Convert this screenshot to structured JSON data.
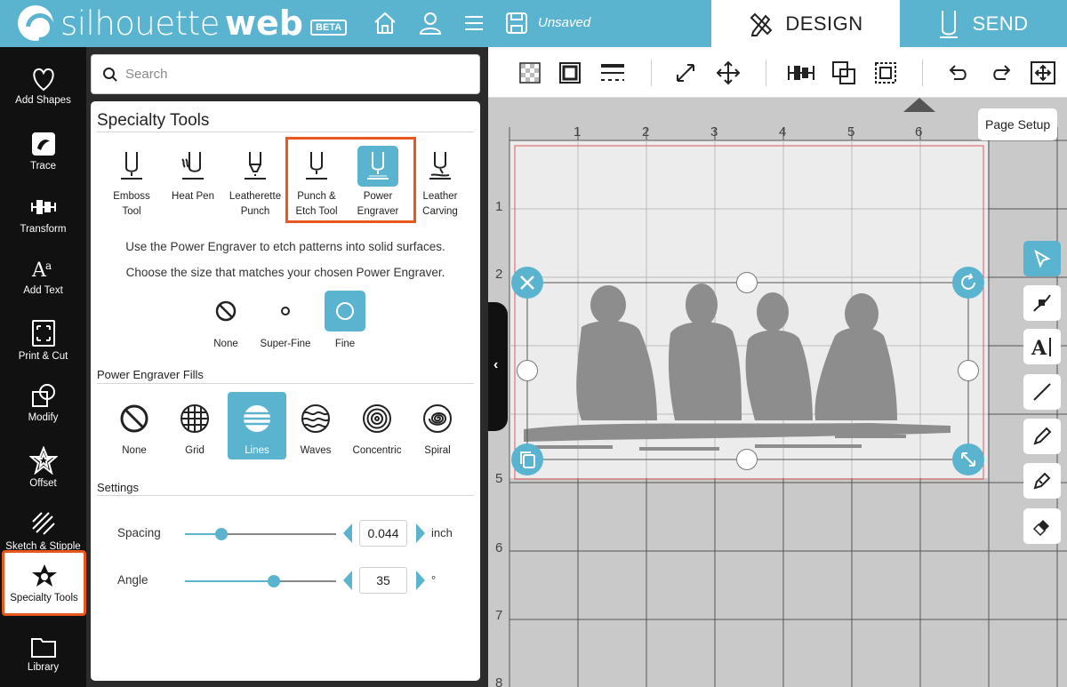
{
  "app": {
    "logo_text": "silhouette",
    "logo_bold": "web",
    "beta_badge": "BETA",
    "doc_status": "Unsaved"
  },
  "tabs": {
    "design": "DESIGN",
    "send": "SEND"
  },
  "sidebar": {
    "items": [
      {
        "label": "Add Shapes",
        "icon": "heart-icon"
      },
      {
        "label": "Trace",
        "icon": "trace-icon"
      },
      {
        "label": "Transform",
        "icon": "transform-icon"
      },
      {
        "label": "Add Text",
        "icon": "text-icon"
      },
      {
        "label": "Print & Cut",
        "icon": "print-cut-icon"
      },
      {
        "label": "Modify",
        "icon": "modify-icon"
      },
      {
        "label": "Offset",
        "icon": "offset-star-icon"
      },
      {
        "label": "Sketch & Stipple",
        "icon": "sketch-icon"
      },
      {
        "label": "Specialty Tools",
        "icon": "specialty-star-icon",
        "active": true
      },
      {
        "label": "Library",
        "icon": "folder-icon"
      }
    ]
  },
  "search": {
    "placeholder": "Search"
  },
  "panel": {
    "title": "Specialty Tools",
    "tools": [
      {
        "line1": "Emboss",
        "line2": "Tool"
      },
      {
        "line1": "Heat Pen",
        "line2": ""
      },
      {
        "line1": "Leatherette",
        "line2": "Punch"
      },
      {
        "line1": "Punch &",
        "line2": "Etch Tool"
      },
      {
        "line1": "Power",
        "line2": "Engraver",
        "selected": true
      },
      {
        "line1": "Leather",
        "line2": "Carving"
      }
    ],
    "description1": "Use the Power Engraver to etch patterns into solid surfaces.",
    "description2": "Choose the size that matches your chosen Power Engraver.",
    "sizes": [
      {
        "label": "None"
      },
      {
        "label": "Super-Fine"
      },
      {
        "label": "Fine",
        "selected": true
      }
    ],
    "fills_title": "Power Engraver Fills",
    "fills": [
      {
        "label": "None"
      },
      {
        "label": "Grid"
      },
      {
        "label": "Lines",
        "selected": true
      },
      {
        "label": "Waves"
      },
      {
        "label": "Concentric"
      },
      {
        "label": "Spiral"
      }
    ],
    "settings_title": "Settings",
    "spacing": {
      "label": "Spacing",
      "value": "0.044",
      "unit": "inch",
      "level": 0.24
    },
    "angle": {
      "label": "Angle",
      "value": "35",
      "unit": "°",
      "level": 0.59
    }
  },
  "canvas": {
    "page_setup": "Page Setup",
    "ruler_top": [
      "1",
      "2",
      "3",
      "4",
      "5",
      "6"
    ],
    "ruler_left": [
      "1",
      "2",
      "5",
      "6",
      "7",
      "8"
    ]
  },
  "colors": {
    "accent": "#5ab3cf",
    "highlight": "#e8581e",
    "sidebar_bg": "#111111"
  }
}
